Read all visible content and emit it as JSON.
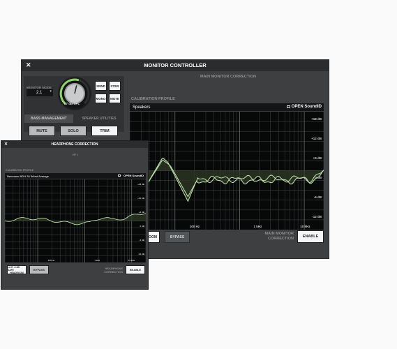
{
  "monitor_window": {
    "title": "MONITOR CONTROLLER",
    "close_glyph": "✕",
    "monitor_mode_label": "MONITOR MODE",
    "monitor_mode_value": "2.1",
    "knob_readout": "57 dB SPL",
    "knob_level": 0.55,
    "mode_buttons": [
      "SRND",
      "STER",
      "MONO",
      "MUTE"
    ],
    "tabs": [
      "BASS MANAGEMENT",
      "SPEAKER UTILITIES"
    ],
    "utility_buttons": [
      "MUTE",
      "SOLO",
      "TRIM"
    ],
    "section_title": "MAIN MONITOR CORRECTION",
    "calibration_label": "CALIBRATION PROFILE",
    "profile_value": "Speakers",
    "soundid_label": "OPEN SoundID",
    "y_labels": [
      "+18 dB",
      "+12 dB",
      "+6 dB",
      "0 dB",
      "-6 dB",
      "-12 dB",
      "-18 dB"
    ],
    "x_labels": [
      "100 Hz",
      "1 kHz",
      "10 kHz"
    ],
    "room_button": "ROOM",
    "bypass_button": "BYPASS",
    "correction_label": [
      "MAIN MONITOR",
      "CORRECTION"
    ],
    "enable_button": "ENABLE"
  },
  "headphone_window": {
    "title": "HEADPHONE CORRECTION",
    "close_glyph": "✕",
    "output_label": "HP 1",
    "calibration_label": "CALIBRATION PROFILE",
    "profile_value": "Neumann NDH 30 Wired Average",
    "soundid_label": "OPEN SoundID",
    "y_labels": [
      "+18 dB",
      "+12 dB",
      "+6 dB",
      "0 dB",
      "-6 dB",
      "-12 dB",
      "-18 dB"
    ],
    "x_labels": [
      "100 Hz",
      "1 kHz",
      "10 kHz"
    ],
    "headroom_button": [
      "L& R -6 dB SAFE",
      "HEADROOM"
    ],
    "bypass_button": "BYPASS",
    "correction_label": [
      "HEADPHONE",
      "CORRECTION"
    ],
    "enable_button": "ENABLE"
  },
  "colors": {
    "window_bg": "#3d3f41",
    "titlebar_bg": "#2b2c2d",
    "graph_bg": "#070808",
    "curve": "#b9d9a6"
  }
}
